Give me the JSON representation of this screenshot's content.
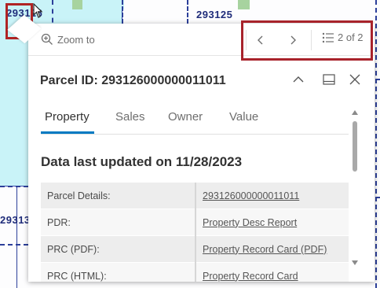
{
  "map": {
    "parcel_label_partial": "2931",
    "parcel_label_partial_suffix": "26",
    "parcel_label_right": "293125",
    "parcel_label_left": "2931",
    "parcel_label_left_suffix": "3"
  },
  "popup": {
    "zoom_label": "Zoom to",
    "pager_label": "2 of 2",
    "title": "Parcel ID: 293126000000011011",
    "tabs": [
      {
        "label": "Property"
      },
      {
        "label": "Sales"
      },
      {
        "label": "Owner"
      },
      {
        "label": "Value"
      }
    ],
    "active_tab": "Property",
    "updated_text": "Data last updated on 11/28/2023",
    "rows": [
      {
        "key": "Parcel Details:",
        "value": "293126000000011011"
      },
      {
        "key": "PDR:",
        "value": "Property Desc Report"
      },
      {
        "key": "PRC (PDF):",
        "value": "Property Record Card (PDF)"
      },
      {
        "key": "PRC (HTML):",
        "value": "Property Record Card"
      }
    ]
  },
  "colors": {
    "accent": "#007ac2",
    "selection_fill": "#c9f3f8",
    "parcel_line": "#2c3f9a",
    "highlight": "#a8232b"
  }
}
